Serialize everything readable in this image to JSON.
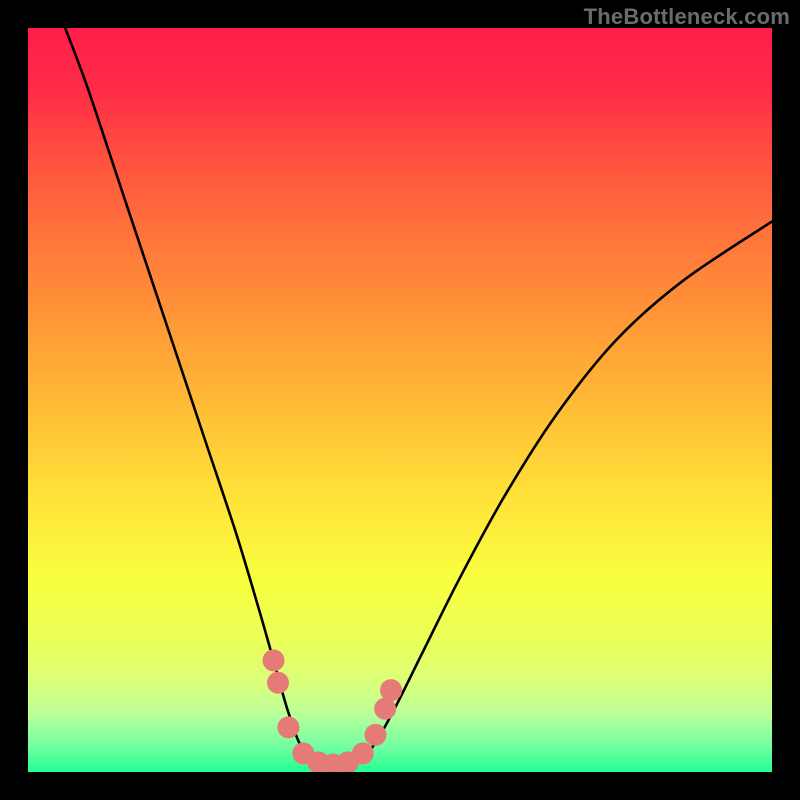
{
  "watermark": "TheBottleneck.com",
  "chart_data": {
    "type": "line",
    "title": "",
    "xlabel": "",
    "ylabel": "",
    "xlim": [
      0,
      100
    ],
    "ylim": [
      0,
      100
    ],
    "background_gradient_stops": [
      {
        "offset": 0.0,
        "color": "#ff1e4a"
      },
      {
        "offset": 0.08,
        "color": "#ff2b47"
      },
      {
        "offset": 0.2,
        "color": "#ff5a3e"
      },
      {
        "offset": 0.35,
        "color": "#ff8a38"
      },
      {
        "offset": 0.5,
        "color": "#ffb936"
      },
      {
        "offset": 0.63,
        "color": "#ffe239"
      },
      {
        "offset": 0.74,
        "color": "#f9ff3f"
      },
      {
        "offset": 0.82,
        "color": "#eaff58"
      },
      {
        "offset": 0.88,
        "color": "#daff79"
      },
      {
        "offset": 0.92,
        "color": "#bcff98"
      },
      {
        "offset": 0.96,
        "color": "#7dffa2"
      },
      {
        "offset": 1.0,
        "color": "#22ff95"
      }
    ],
    "curve": {
      "description": "V-shaped bottleneck curve; minimum around x≈40",
      "points": [
        {
          "x": 5.0,
          "y": 100.0
        },
        {
          "x": 8.0,
          "y": 92.0
        },
        {
          "x": 12.0,
          "y": 80.0
        },
        {
          "x": 16.0,
          "y": 68.0
        },
        {
          "x": 20.0,
          "y": 56.0
        },
        {
          "x": 24.0,
          "y": 44.0
        },
        {
          "x": 28.0,
          "y": 32.0
        },
        {
          "x": 31.0,
          "y": 22.0
        },
        {
          "x": 33.0,
          "y": 15.0
        },
        {
          "x": 35.0,
          "y": 8.0
        },
        {
          "x": 37.0,
          "y": 3.0
        },
        {
          "x": 40.0,
          "y": 1.0
        },
        {
          "x": 43.0,
          "y": 1.0
        },
        {
          "x": 46.0,
          "y": 3.0
        },
        {
          "x": 49.0,
          "y": 8.0
        },
        {
          "x": 53.0,
          "y": 16.0
        },
        {
          "x": 58.0,
          "y": 26.0
        },
        {
          "x": 64.0,
          "y": 37.0
        },
        {
          "x": 71.0,
          "y": 48.0
        },
        {
          "x": 79.0,
          "y": 58.0
        },
        {
          "x": 88.0,
          "y": 66.0
        },
        {
          "x": 100.0,
          "y": 74.0
        }
      ]
    },
    "markers": {
      "description": "salmon dot-and-horseshoe markers near bottom of V",
      "points": [
        {
          "x": 33.0,
          "y": 15.0
        },
        {
          "x": 33.6,
          "y": 12.0
        },
        {
          "x": 35.0,
          "y": 6.0
        },
        {
          "x": 37.0,
          "y": 2.5
        },
        {
          "x": 39.0,
          "y": 1.3
        },
        {
          "x": 41.0,
          "y": 1.0
        },
        {
          "x": 43.0,
          "y": 1.3
        },
        {
          "x": 45.0,
          "y": 2.5
        },
        {
          "x": 46.7,
          "y": 5.0
        },
        {
          "x": 48.0,
          "y": 8.5
        },
        {
          "x": 48.8,
          "y": 11.0
        }
      ],
      "color": "#e57b77",
      "radius_px": 11
    }
  }
}
